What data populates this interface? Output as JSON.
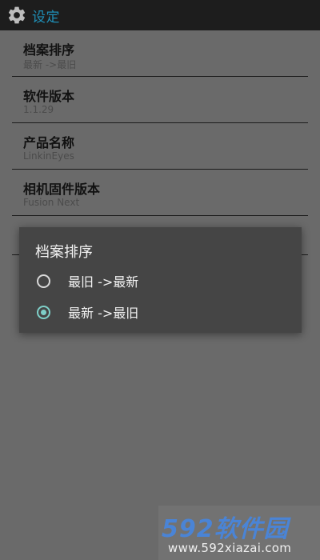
{
  "topbar": {
    "icon": "gear-icon",
    "title": "设定"
  },
  "settings": [
    {
      "label": "档案排序",
      "value": "最新 ->最旧"
    },
    {
      "label": "软件版本",
      "value": "1.1.29"
    },
    {
      "label": "产品名称",
      "value": "LinkinEyes"
    },
    {
      "label": "相机固件版本",
      "value": "Fusion Next"
    }
  ],
  "dialog": {
    "title": "档案排序",
    "options": [
      {
        "label": "最旧 ->最新",
        "selected": false
      },
      {
        "label": "最新 ->最旧",
        "selected": true
      }
    ]
  },
  "watermark": {
    "brand": "592软件园",
    "url": "www.592xiazai.com"
  },
  "colors": {
    "topbar_bg": "#1d1d1d",
    "title_color": "#1f8fb7",
    "dialog_bg": "#454545",
    "radio_accent": "#7ecfc8",
    "watermark_brand": "#4a84d6"
  }
}
